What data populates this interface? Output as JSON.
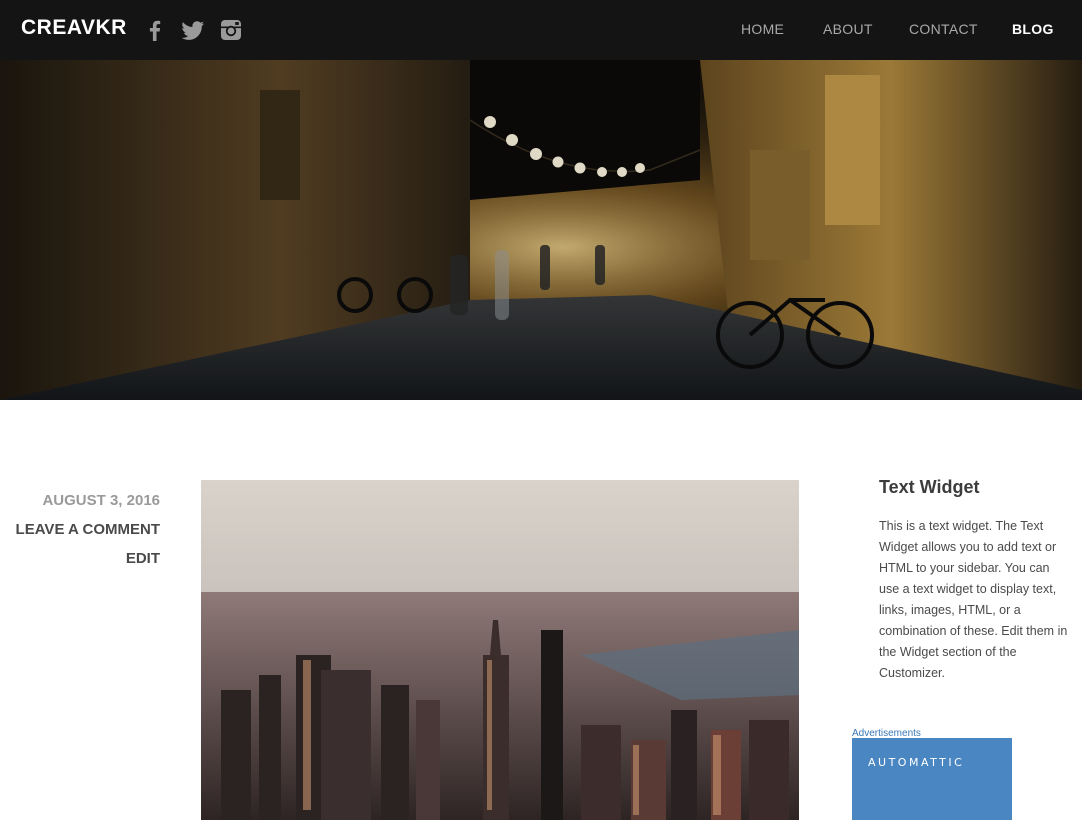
{
  "header": {
    "brand": "CREAVKR",
    "social": [
      "facebook-icon",
      "twitter-icon",
      "instagram-icon"
    ],
    "nav": [
      {
        "label": "HOME",
        "active": false
      },
      {
        "label": "ABOUT",
        "active": false
      },
      {
        "label": "CONTACT",
        "active": false
      },
      {
        "label": "BLOG",
        "active": true
      }
    ]
  },
  "post": {
    "date": "AUGUST 3, 2016",
    "comment_link": "LEAVE A COMMENT",
    "edit_link": "EDIT"
  },
  "sidebar": {
    "widget_title": "Text Widget",
    "widget_text": "This is a text widget. The Text Widget allows you to add text or HTML to your sidebar. You can use a text widget to display text, links, images, HTML, or a combination of these. Edit them in the Widget section of the Customizer.",
    "ads_label": "Advertisements",
    "ad_text": "AUTOMATTIC"
  },
  "colors": {
    "header_bg": "#141414",
    "nav_inactive": "#a9a9a9",
    "nav_active": "#ffffff",
    "ad_bg": "#4a86c2"
  }
}
